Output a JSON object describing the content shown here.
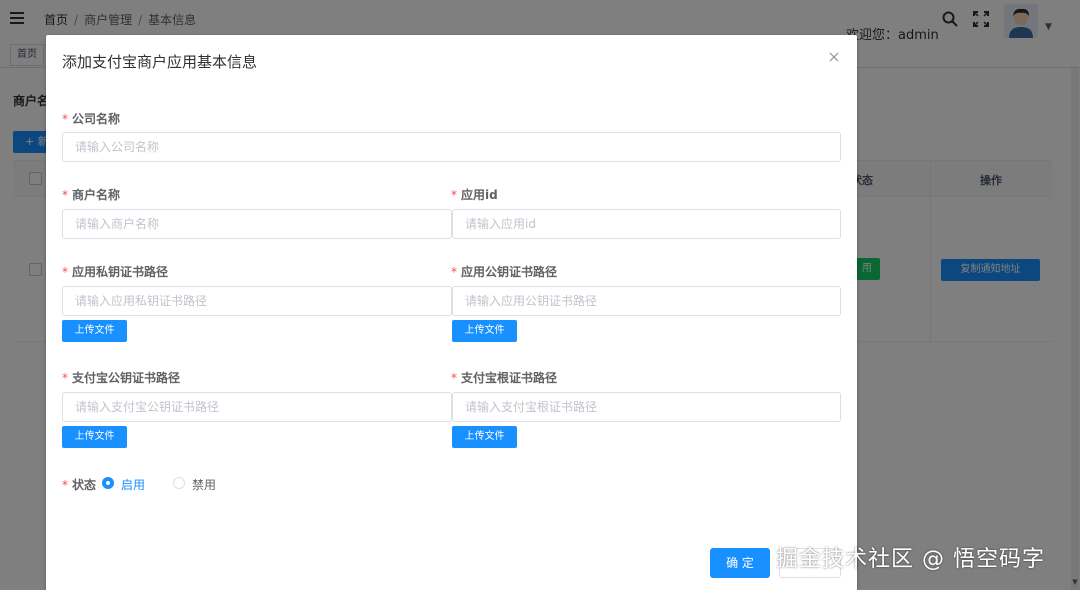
{
  "header": {
    "breadcrumb": [
      "首页",
      "商户管理",
      "基本信息"
    ],
    "welcome": "欢迎您：admin",
    "icons": [
      "menu-toggle-icon",
      "search-icon",
      "fullscreen-icon",
      "user-avatar",
      "caret-down-icon"
    ]
  },
  "tags_view": {
    "tags": [
      "首页"
    ]
  },
  "page": {
    "label": "商户名",
    "add_button": "+ 新",
    "table": {
      "columns": [
        "状态",
        "操作"
      ]
    },
    "row": {
      "status_tag": "用",
      "copy_button": "复制通知地址"
    }
  },
  "modal": {
    "title": "添加支付宝商户应用基本信息",
    "fields": {
      "company_name": {
        "label": "公司名称",
        "placeholder": "请输入公司名称",
        "required": true
      },
      "merchant_name": {
        "label": "商户名称",
        "placeholder": "请输入商户名称",
        "required": true
      },
      "app_id": {
        "label": "应用id",
        "placeholder": "请输入应用id",
        "required": true
      },
      "app_private_cert": {
        "label": "应用私钥证书路径",
        "placeholder": "请输入应用私钥证书路径",
        "required": true,
        "upload": "上传文件"
      },
      "app_public_cert": {
        "label": "应用公钥证书路径",
        "placeholder": "请输入应用公钥证书路径",
        "required": true,
        "upload": "上传文件"
      },
      "alipay_public_cert": {
        "label": "支付宝公钥证书路径",
        "placeholder": "请输入支付宝公钥证书路径",
        "required": true,
        "upload": "上传文件"
      },
      "alipay_root_cert": {
        "label": "支付宝根证书路径",
        "placeholder": "请输入支付宝根证书路径",
        "required": true,
        "upload": "上传文件"
      }
    },
    "status": {
      "label": "状态",
      "options": [
        "启用",
        "禁用"
      ],
      "selected": "启用"
    },
    "buttons": {
      "confirm": "确 定",
      "cancel": ""
    }
  },
  "colors": {
    "primary": "#1890ff",
    "success": "#13ce66",
    "required": "#ff4949",
    "overlay": "rgba(0,0,0,0.5)"
  },
  "watermark": "掘金技术社区 @ 悟空码字"
}
